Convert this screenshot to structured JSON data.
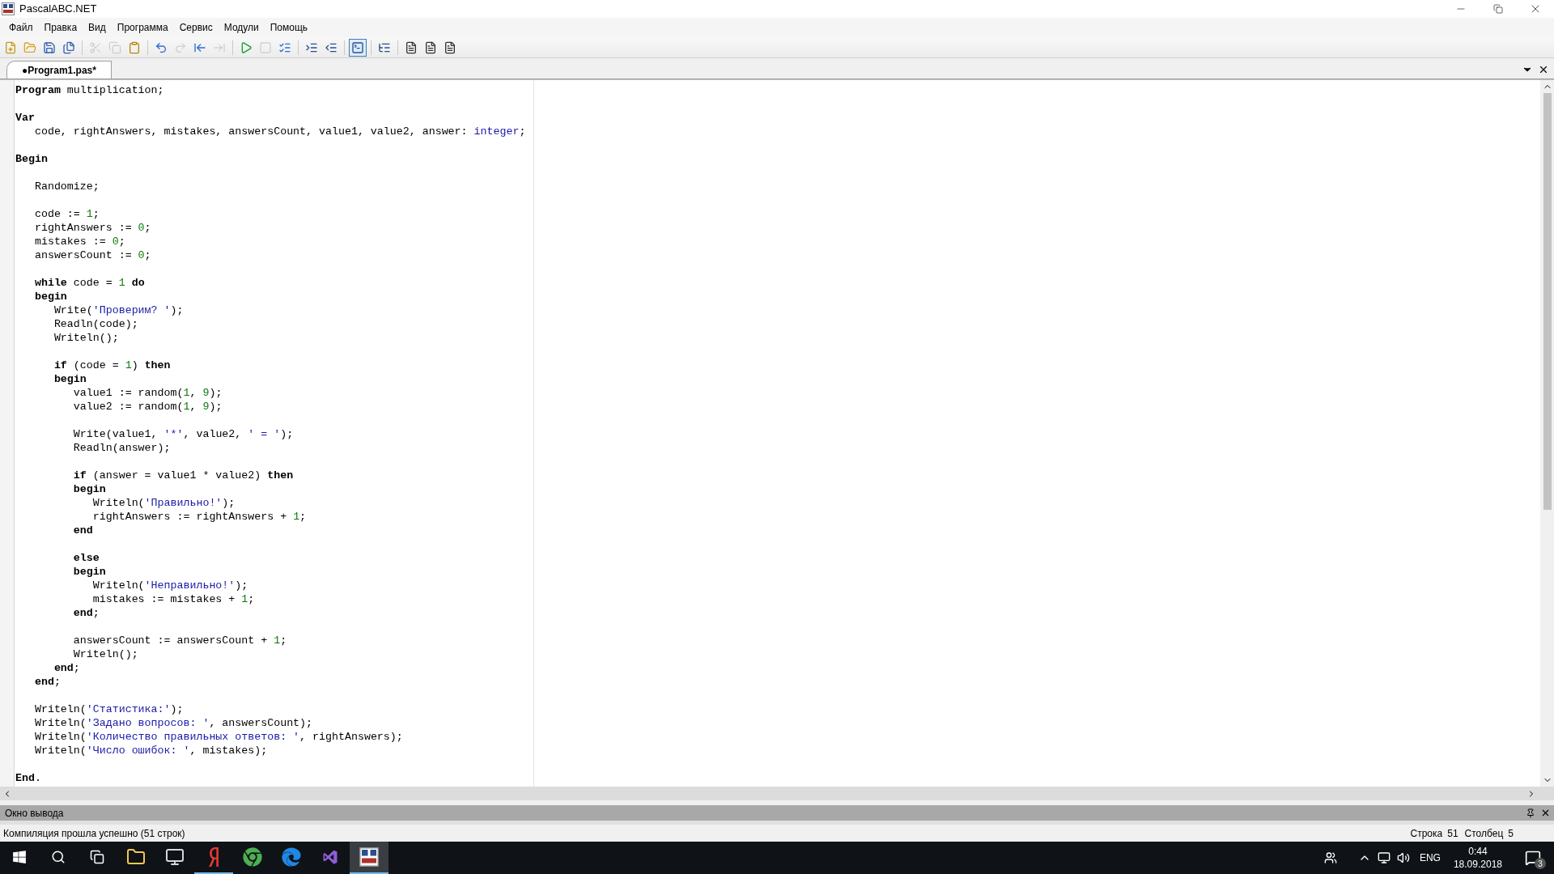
{
  "window": {
    "title": "PascalABC.NET"
  },
  "menu": [
    "Файл",
    "Правка",
    "Вид",
    "Программа",
    "Сервис",
    "Модули",
    "Помощь"
  ],
  "toolbar": [
    {
      "kind": "new",
      "disabled": false,
      "pressed": false
    },
    {
      "kind": "open",
      "disabled": false,
      "pressed": false
    },
    {
      "kind": "save",
      "disabled": false,
      "pressed": false
    },
    {
      "kind": "saveall",
      "disabled": false,
      "pressed": false
    },
    {
      "kind": "sep"
    },
    {
      "kind": "cut",
      "disabled": true,
      "pressed": false
    },
    {
      "kind": "copy",
      "disabled": true,
      "pressed": false
    },
    {
      "kind": "paste",
      "disabled": false,
      "pressed": false
    },
    {
      "kind": "sep"
    },
    {
      "kind": "undo",
      "disabled": false,
      "pressed": false
    },
    {
      "kind": "redo",
      "disabled": true,
      "pressed": false
    },
    {
      "kind": "back",
      "disabled": false,
      "pressed": false
    },
    {
      "kind": "forward",
      "disabled": true,
      "pressed": false
    },
    {
      "kind": "sep"
    },
    {
      "kind": "run",
      "disabled": false,
      "pressed": false
    },
    {
      "kind": "stop",
      "disabled": true,
      "pressed": false
    },
    {
      "kind": "compile",
      "disabled": false,
      "pressed": false
    },
    {
      "kind": "sep"
    },
    {
      "kind": "indent",
      "disabled": false,
      "pressed": false
    },
    {
      "kind": "outdent",
      "disabled": false,
      "pressed": false
    },
    {
      "kind": "sep"
    },
    {
      "kind": "console",
      "disabled": false,
      "pressed": true
    },
    {
      "kind": "sep"
    },
    {
      "kind": "list",
      "disabled": false,
      "pressed": false
    },
    {
      "kind": "sep"
    },
    {
      "kind": "doc",
      "disabled": false,
      "pressed": false
    },
    {
      "kind": "doc",
      "disabled": false,
      "pressed": false
    },
    {
      "kind": "doc",
      "disabled": false,
      "pressed": false
    }
  ],
  "tabs": [
    {
      "label": "●Program1.pas*",
      "selected": true
    }
  ],
  "code_lines": [
    {
      "kind": "code",
      "tokens": [
        {
          "kind": "kw",
          "text": "Program"
        },
        {
          "kind": "txt",
          "text": " multiplication;"
        }
      ]
    },
    {
      "kind": "blank"
    },
    {
      "kind": "code",
      "tokens": [
        {
          "kind": "kw",
          "text": "Var"
        }
      ]
    },
    {
      "kind": "code",
      "tokens": [
        {
          "kind": "txt",
          "text": "   code, rightAnswers, mistakes, answersCount, value1, value2, answer: "
        },
        {
          "kind": "type",
          "text": "integer"
        },
        {
          "kind": "txt",
          "text": ";"
        }
      ]
    },
    {
      "kind": "blank"
    },
    {
      "kind": "code",
      "tokens": [
        {
          "kind": "kw",
          "text": "Begin"
        }
      ]
    },
    {
      "kind": "blank"
    },
    {
      "kind": "code",
      "tokens": [
        {
          "kind": "txt",
          "text": "   Randomize;"
        }
      ]
    },
    {
      "kind": "blank"
    },
    {
      "kind": "code",
      "tokens": [
        {
          "kind": "txt",
          "text": "   code := "
        },
        {
          "kind": "num",
          "text": "1"
        },
        {
          "kind": "txt",
          "text": ";"
        }
      ]
    },
    {
      "kind": "code",
      "tokens": [
        {
          "kind": "txt",
          "text": "   rightAnswers := "
        },
        {
          "kind": "num",
          "text": "0"
        },
        {
          "kind": "txt",
          "text": ";"
        }
      ]
    },
    {
      "kind": "code",
      "tokens": [
        {
          "kind": "txt",
          "text": "   mistakes := "
        },
        {
          "kind": "num",
          "text": "0"
        },
        {
          "kind": "txt",
          "text": ";"
        }
      ]
    },
    {
      "kind": "code",
      "tokens": [
        {
          "kind": "txt",
          "text": "   answersCount := "
        },
        {
          "kind": "num",
          "text": "0"
        },
        {
          "kind": "txt",
          "text": ";"
        }
      ]
    },
    {
      "kind": "blank"
    },
    {
      "kind": "code",
      "tokens": [
        {
          "kind": "kw",
          "text": "   while"
        },
        {
          "kind": "txt",
          "text": " code = "
        },
        {
          "kind": "num",
          "text": "1"
        },
        {
          "kind": "kw",
          "text": " do"
        }
      ]
    },
    {
      "kind": "code",
      "tokens": [
        {
          "kind": "kw",
          "text": "   begin"
        }
      ]
    },
    {
      "kind": "code",
      "tokens": [
        {
          "kind": "txt",
          "text": "      Write("
        },
        {
          "kind": "str",
          "text": "'Проверим? '"
        },
        {
          "kind": "txt",
          "text": ");"
        }
      ]
    },
    {
      "kind": "code",
      "tokens": [
        {
          "kind": "txt",
          "text": "      Readln(code);"
        }
      ]
    },
    {
      "kind": "code",
      "tokens": [
        {
          "kind": "txt",
          "text": "      Writeln();"
        }
      ]
    },
    {
      "kind": "blank"
    },
    {
      "kind": "code",
      "tokens": [
        {
          "kind": "kw",
          "text": "      if"
        },
        {
          "kind": "txt",
          "text": " (code = "
        },
        {
          "kind": "num",
          "text": "1"
        },
        {
          "kind": "txt",
          "text": ") "
        },
        {
          "kind": "kw",
          "text": "then"
        }
      ]
    },
    {
      "kind": "code",
      "tokens": [
        {
          "kind": "kw",
          "text": "      begin"
        }
      ]
    },
    {
      "kind": "code",
      "tokens": [
        {
          "kind": "txt",
          "text": "         value1 := random("
        },
        {
          "kind": "num",
          "text": "1"
        },
        {
          "kind": "txt",
          "text": ", "
        },
        {
          "kind": "num",
          "text": "9"
        },
        {
          "kind": "txt",
          "text": ");"
        }
      ]
    },
    {
      "kind": "code",
      "tokens": [
        {
          "kind": "txt",
          "text": "         value2 := random("
        },
        {
          "kind": "num",
          "text": "1"
        },
        {
          "kind": "txt",
          "text": ", "
        },
        {
          "kind": "num",
          "text": "9"
        },
        {
          "kind": "txt",
          "text": ");"
        }
      ]
    },
    {
      "kind": "blank"
    },
    {
      "kind": "code",
      "tokens": [
        {
          "kind": "txt",
          "text": "         Write(value1, "
        },
        {
          "kind": "str",
          "text": "'*'"
        },
        {
          "kind": "txt",
          "text": ", value2, "
        },
        {
          "kind": "str",
          "text": "' = '"
        },
        {
          "kind": "txt",
          "text": ");"
        }
      ]
    },
    {
      "kind": "code",
      "tokens": [
        {
          "kind": "txt",
          "text": "         Readln(answer);"
        }
      ]
    },
    {
      "kind": "blank"
    },
    {
      "kind": "code",
      "tokens": [
        {
          "kind": "kw",
          "text": "         if"
        },
        {
          "kind": "txt",
          "text": " (answer = value1 * value2) "
        },
        {
          "kind": "kw",
          "text": "then"
        }
      ]
    },
    {
      "kind": "code",
      "tokens": [
        {
          "kind": "kw",
          "text": "         begin"
        }
      ]
    },
    {
      "kind": "code",
      "tokens": [
        {
          "kind": "txt",
          "text": "            Writeln("
        },
        {
          "kind": "str",
          "text": "'Правильно!'"
        },
        {
          "kind": "txt",
          "text": ");"
        }
      ]
    },
    {
      "kind": "code",
      "tokens": [
        {
          "kind": "txt",
          "text": "            rightAnswers := rightAnswers + "
        },
        {
          "kind": "num",
          "text": "1"
        },
        {
          "kind": "txt",
          "text": ";"
        }
      ]
    },
    {
      "kind": "code",
      "tokens": [
        {
          "kind": "kw",
          "text": "         end"
        }
      ]
    },
    {
      "kind": "blank"
    },
    {
      "kind": "code",
      "tokens": [
        {
          "kind": "kw",
          "text": "         else"
        }
      ]
    },
    {
      "kind": "code",
      "tokens": [
        {
          "kind": "kw",
          "text": "         begin"
        }
      ]
    },
    {
      "kind": "code",
      "tokens": [
        {
          "kind": "txt",
          "text": "            Writeln("
        },
        {
          "kind": "str",
          "text": "'Неправильно!'"
        },
        {
          "kind": "txt",
          "text": ");"
        }
      ]
    },
    {
      "kind": "code",
      "tokens": [
        {
          "kind": "txt",
          "text": "            mistakes := mistakes + "
        },
        {
          "kind": "num",
          "text": "1"
        },
        {
          "kind": "txt",
          "text": ";"
        }
      ]
    },
    {
      "kind": "code",
      "tokens": [
        {
          "kind": "kw",
          "text": "         end"
        },
        {
          "kind": "txt",
          "text": ";"
        }
      ]
    },
    {
      "kind": "blank"
    },
    {
      "kind": "code",
      "tokens": [
        {
          "kind": "txt",
          "text": "         answersCount := answersCount + "
        },
        {
          "kind": "num",
          "text": "1"
        },
        {
          "kind": "txt",
          "text": ";"
        }
      ]
    },
    {
      "kind": "code",
      "tokens": [
        {
          "kind": "txt",
          "text": "         Writeln();"
        }
      ]
    },
    {
      "kind": "code",
      "tokens": [
        {
          "kind": "kw",
          "text": "      end"
        },
        {
          "kind": "txt",
          "text": ";"
        }
      ]
    },
    {
      "kind": "code",
      "tokens": [
        {
          "kind": "kw",
          "text": "   end"
        },
        {
          "kind": "txt",
          "text": ";"
        }
      ]
    },
    {
      "kind": "blank"
    },
    {
      "kind": "code",
      "tokens": [
        {
          "kind": "txt",
          "text": "   Writeln("
        },
        {
          "kind": "str",
          "text": "'Статистика:'"
        },
        {
          "kind": "txt",
          "text": ");"
        }
      ]
    },
    {
      "kind": "code",
      "tokens": [
        {
          "kind": "txt",
          "text": "   Writeln("
        },
        {
          "kind": "str",
          "text": "'Задано вопросов: '"
        },
        {
          "kind": "txt",
          "text": ", answersCount);"
        }
      ]
    },
    {
      "kind": "code",
      "tokens": [
        {
          "kind": "txt",
          "text": "   Writeln("
        },
        {
          "kind": "str",
          "text": "'Количество правильных ответов: '"
        },
        {
          "kind": "txt",
          "text": ", rightAnswers);"
        }
      ]
    },
    {
      "kind": "code",
      "tokens": [
        {
          "kind": "txt",
          "text": "   Writeln("
        },
        {
          "kind": "str",
          "text": "'Число ошибок: '"
        },
        {
          "kind": "txt",
          "text": ", mistakes);"
        }
      ]
    },
    {
      "kind": "blank"
    },
    {
      "kind": "code",
      "tokens": [
        {
          "kind": "kw",
          "text": "End"
        },
        {
          "kind": "txt",
          "text": "."
        }
      ]
    }
  ],
  "output_panel": {
    "title": "Окно вывода"
  },
  "status_bar": {
    "message": "Компиляция прошла успешно (51 строк)",
    "line_label": "Строка",
    "line": "51",
    "column_label": "Столбец",
    "column": "5"
  },
  "taskbar": {
    "apps": [
      {
        "kind": "start",
        "running": false,
        "active": false
      },
      {
        "kind": "search",
        "running": false,
        "active": false
      },
      {
        "kind": "taskview",
        "running": false,
        "active": false
      },
      {
        "kind": "folder",
        "running": false,
        "active": false
      },
      {
        "kind": "monitor",
        "running": false,
        "active": false
      },
      {
        "kind": "ybrowser",
        "running": true,
        "active": false
      },
      {
        "kind": "cbrowser",
        "running": false,
        "active": false
      },
      {
        "kind": "ebrowser",
        "running": false,
        "active": false
      },
      {
        "kind": "ide",
        "running": false,
        "active": false
      },
      {
        "kind": "pascal",
        "running": true,
        "active": true
      }
    ],
    "language": "ENG",
    "time": "0:44",
    "date": "18.09.2018",
    "notifications": "3"
  }
}
